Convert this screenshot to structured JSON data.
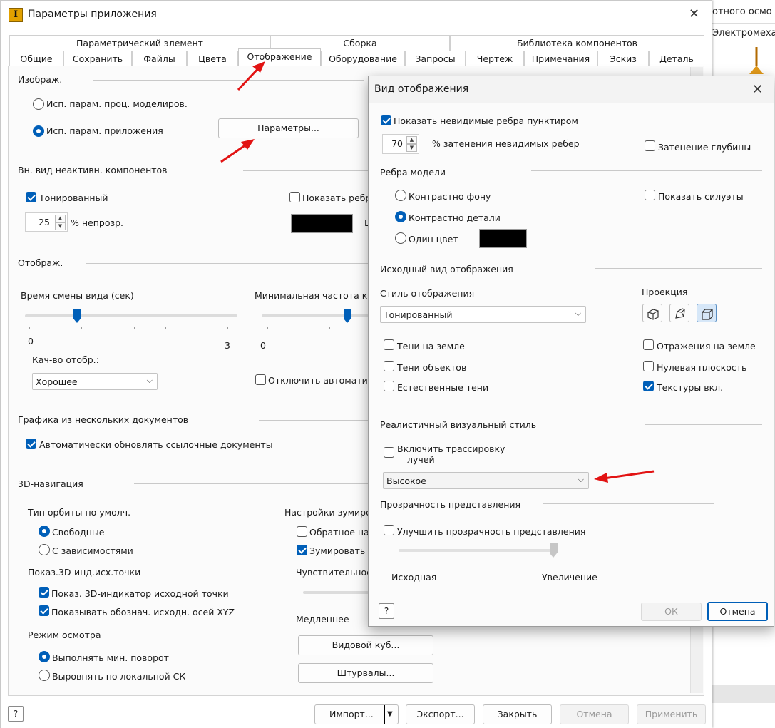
{
  "background": {
    "text_line1": "отного осмо",
    "text_line2": "Электромеха"
  },
  "main": {
    "title": "Параметры приложения",
    "tabs_row1": [
      "Параметрический элемент",
      "Сборка",
      "Библиотека компонентов"
    ],
    "tabs_row2": [
      "Общие",
      "Сохранить",
      "Файлы",
      "Цвета",
      "Отображение",
      "Оборудование",
      "Запросы",
      "Чертеж",
      "Примечания",
      "Эскиз",
      "Деталь"
    ],
    "active_tab": "Отображение",
    "image": {
      "heading": "Изображ.",
      "radio1": "Исп. парам. проц. моделиров.",
      "radio2": "Исп. парам. приложения",
      "params_button": "Параметры..."
    },
    "inactive": {
      "heading": "Вн. вид неактивн. компонентов",
      "toned": "Тонированный",
      "show_edges": "Показать ребра",
      "opacity": "25",
      "opacity_label": "% непрозр.",
      "trailing": "L"
    },
    "display": {
      "heading": "Отображ.",
      "view_time": "Время смены вида (сек)",
      "view_time_min": "0",
      "view_time_max": "3",
      "view_time_value": 0.25,
      "min_rate": "Минимальная частота кадр",
      "min_rate_min": "0",
      "min_rate_value": 0.8,
      "quality_label": "Кач-во отобр.:",
      "quality_value": "Хорошее",
      "disable_auto": "Отключить автоматиче"
    },
    "multidoc": {
      "heading": "Графика из нескольких документов",
      "auto_update": "Автоматически обновлять ссылочные документы"
    },
    "nav3d": {
      "heading": "3D-навигация",
      "orbit_type": "Тип орбиты по умолч.",
      "free": "Свободные",
      "constrained": "С зависимостями",
      "zoom_settings": "Настройки зумирова",
      "reverse": "Обратное нап",
      "zoom_to": "Зумировать д",
      "origin_heading": "Показ.3D-инд.исх.точки",
      "show_indicator": "Показ. 3D-индикатор исходной точки",
      "show_axes": "Показывать обознач. исходн. осей XYZ",
      "sensitivity": "Чувствительност",
      "slower": "Медленнее",
      "viewcube": "Видовой куб...",
      "review_mode": "Режим осмотра",
      "min_rotation": "Выполнять мин. поворот",
      "align_local": "Выровнять по локальной СК",
      "steering": "Штурвалы..."
    },
    "footer": {
      "help": "?",
      "import": "Импорт...",
      "export": "Экспорт...",
      "close": "Закрыть",
      "cancel": "Отмена",
      "apply": "Применить"
    }
  },
  "dialog": {
    "title": "Вид отображения",
    "show_hidden_edges": "Показать невидимые ребра пунктиром",
    "shade_value": "70",
    "shade_label": "% затенения невидимых ребер",
    "depth_shade": "Затенение глубины",
    "model_edges": "Ребра модели",
    "contrast_bg": "Контрастно фону",
    "contrast_part": "Контрастно детали",
    "one_color": "Один цвет",
    "show_silhouettes": "Показать силуэты",
    "initial_view": "Исходный вид отображения",
    "style_label": "Стиль отображения",
    "style_value": "Тонированный",
    "projection": "Проекция",
    "ground_shadows": "Тени на земле",
    "object_shadows": "Тени объектов",
    "natural_shadows": "Естественные тени",
    "ground_reflections": "Отражения на земле",
    "zero_plane": "Нулевая плоскость",
    "textures_on": "Текстуры вкл.",
    "realistic": "Реалистичный визуальный стиль",
    "ray_tracing_1": "Включить трассировку",
    "ray_tracing_2": "лучей",
    "quality_value": "Высокое",
    "transparency": "Прозрачность представления",
    "improve_transparency": "Улучшить прозрачность представления",
    "source": "Исходная",
    "increase": "Увеличение",
    "help": "?",
    "ok": "ОК",
    "cancel": "Отмена"
  },
  "colors": {
    "accent": "#005fb8",
    "arrow": "#e21313",
    "swatch": "#000000"
  }
}
